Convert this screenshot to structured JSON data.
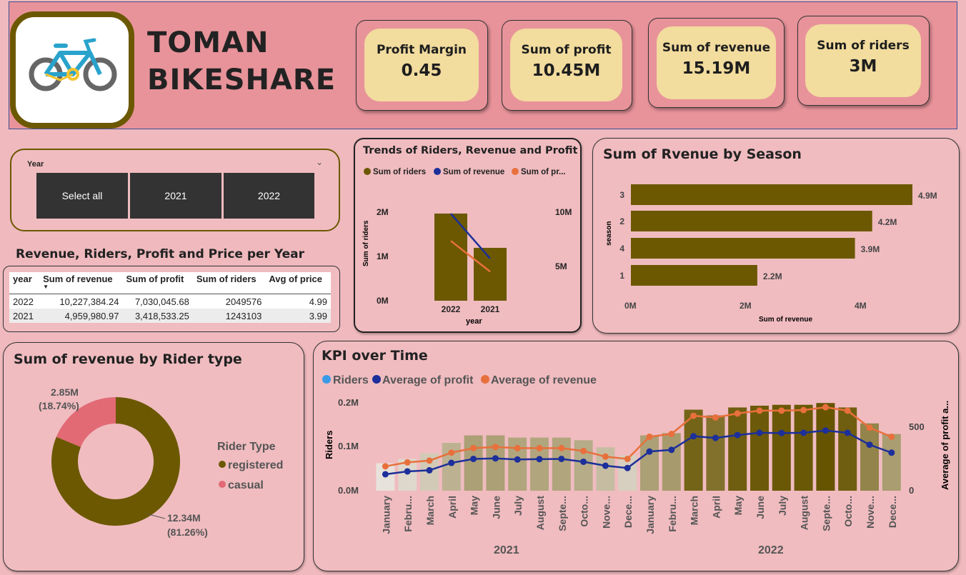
{
  "brand": {
    "line1": "TOMAN",
    "line2": "BIKESHARE"
  },
  "kpis": [
    {
      "label": "Profit Margin",
      "value": "0.45"
    },
    {
      "label": "Sum of profit",
      "value": "10.45M"
    },
    {
      "label": "Sum of revenue",
      "value": "15.19M"
    },
    {
      "label": "Sum of riders",
      "value": "3M"
    }
  ],
  "slicer": {
    "title": "Year",
    "options": [
      "Select all",
      "2021",
      "2022"
    ],
    "chevron_icon": "chevron-down-icon"
  },
  "table": {
    "title": "Revenue, Riders, Profit and Price per Year",
    "columns": [
      "year",
      "Sum of revenue",
      "Sum of profit",
      "Sum of riders",
      "Avg of price"
    ],
    "rows": [
      [
        "2022",
        "10,227,384.24",
        "7,030,045.68",
        "2049576",
        "4.99"
      ],
      [
        "2021",
        "4,959,980.97",
        "3,418,533.25",
        "1243103",
        "3.99"
      ]
    ]
  },
  "trends": {
    "title": "Trends of Riders, Revenue and Profit",
    "legend": [
      "Sum of riders",
      "Sum of revenue",
      "Sum of pr..."
    ],
    "ylabel": "Sum of riders",
    "xlabel": "year",
    "yticks": [
      "0M",
      "1M",
      "2M"
    ],
    "y2ticks": [
      "5M",
      "10M"
    ]
  },
  "season": {
    "title": "Sum of Rvenue by Season",
    "ylabel": "season",
    "xlabel": "Sum of revenue",
    "xticks": [
      "0M",
      "2M",
      "4M"
    ]
  },
  "ridertype": {
    "title": "Sum of revenue by Rider type",
    "legend_title": "Rider Type",
    "legend": [
      "registered",
      "casual"
    ],
    "label_casual": [
      "2.85M",
      "(18.74%)"
    ],
    "label_registered": [
      "12.34M",
      "(81.26%)"
    ]
  },
  "kpitime": {
    "title": "KPI over Time",
    "legend": [
      "Riders",
      "Average of profit",
      "Average of revenue"
    ],
    "ylabel": "Riders",
    "y2label": "Average of profit a...",
    "yticks": [
      "0.0M",
      "0.1M",
      "0.2M"
    ],
    "y2ticks": [
      "0",
      "500"
    ],
    "year_labels": [
      "2021",
      "2022"
    ]
  },
  "colors": {
    "olive": "#6b5800",
    "blue": "#1c2f9a",
    "orange": "#e8703c",
    "casual": "#e26a75",
    "lightblue": "#3b9ae8"
  },
  "chart_data": [
    {
      "type": "bar",
      "title": "Trends of Riders, Revenue and Profit",
      "xlabel": "year",
      "ylabel": "Sum of riders",
      "categories": [
        "2022",
        "2021"
      ],
      "series": [
        {
          "name": "Sum of riders",
          "kind": "bar",
          "values": [
            2049576,
            1243103
          ]
        },
        {
          "name": "Sum of revenue",
          "kind": "line",
          "axis": "secondary",
          "values": [
            10227384.24,
            4959980.97
          ]
        },
        {
          "name": "Sum of pr...",
          "kind": "line",
          "axis": "secondary",
          "values": [
            7030045.68,
            3418533.25
          ]
        }
      ],
      "ylim": [
        0,
        2200000
      ],
      "y2lim": [
        0,
        11000000
      ]
    },
    {
      "type": "bar",
      "orientation": "horizontal",
      "title": "Sum of Rvenue by Season",
      "xlabel": "Sum of revenue",
      "ylabel": "season",
      "categories": [
        "3",
        "2",
        "4",
        "1"
      ],
      "values": [
        4900000,
        4200000,
        3900000,
        2200000
      ],
      "data_labels": [
        "4.9M",
        "4.2M",
        "3.9M",
        "2.2M"
      ],
      "xlim": [
        0,
        4900000
      ]
    },
    {
      "type": "pie",
      "donut": true,
      "title": "Sum of revenue by Rider type",
      "categories": [
        "registered",
        "casual"
      ],
      "values": [
        12.34,
        2.85
      ],
      "percents": [
        81.26,
        18.74
      ]
    },
    {
      "type": "bar",
      "title": "KPI over Time",
      "ylabel": "Riders",
      "x": [
        "January",
        "Febru...",
        "March",
        "April",
        "May",
        "June",
        "July",
        "August",
        "Septe...",
        "Octo...",
        "Nove...",
        "Dece...",
        "January",
        "Febru...",
        "March",
        "April",
        "May",
        "June",
        "July",
        "August",
        "Septe...",
        "Octo...",
        "Nove...",
        "Dece..."
      ],
      "groups": [
        {
          "label": "2021",
          "count": 12
        },
        {
          "label": "2022",
          "count": 12
        }
      ],
      "series": [
        {
          "name": "Riders",
          "kind": "bar",
          "values": [
            62000,
            72000,
            85000,
            108000,
            125000,
            125000,
            120000,
            120000,
            120000,
            114000,
            98000,
            80000,
            125000,
            130000,
            183000,
            170000,
            188000,
            192000,
            194000,
            194000,
            198000,
            188000,
            152000,
            128000
          ]
        },
        {
          "name": "Average of profit",
          "kind": "line",
          "axis": "secondary",
          "values": [
            145,
            170,
            180,
            245,
            280,
            285,
            275,
            278,
            280,
            255,
            220,
            200,
            345,
            360,
            480,
            465,
            490,
            510,
            508,
            510,
            530,
            510,
            405,
            335
          ]
        },
        {
          "name": "Average of revenue",
          "kind": "line",
          "axis": "secondary",
          "values": [
            215,
            250,
            265,
            335,
            375,
            385,
            375,
            375,
            375,
            350,
            300,
            280,
            475,
            500,
            660,
            645,
            680,
            705,
            705,
            710,
            735,
            705,
            555,
            475
          ]
        }
      ],
      "ylim": [
        0,
        0.2
      ],
      "y2lim": [
        0,
        780
      ]
    }
  ]
}
